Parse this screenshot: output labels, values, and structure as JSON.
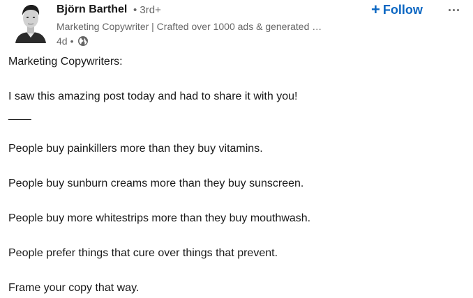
{
  "author": {
    "name": "Björn Barthel",
    "degree": "• 3rd+",
    "headline": "Marketing Copywriter | Crafted over 1000 ads & generated …",
    "age": "4d",
    "visibility_icon": "globe-icon"
  },
  "actions": {
    "follow_plus": "+",
    "follow_label": "Follow",
    "more_icon": "ellipsis-icon"
  },
  "post": {
    "lines": [
      "Marketing Copywriters:",
      "I saw this amazing post today and had to share it with you!",
      "____",
      "People buy painkillers more than they buy vitamins.",
      "People buy sunburn creams more than they buy sunscreen.",
      "People buy more whitestrips more than they buy mouthwash.",
      "People prefer things that cure over things that prevent.",
      "Frame your copy that way."
    ]
  },
  "colors": {
    "accent": "#0a66c2",
    "text": "#191919",
    "muted": "#666666"
  }
}
